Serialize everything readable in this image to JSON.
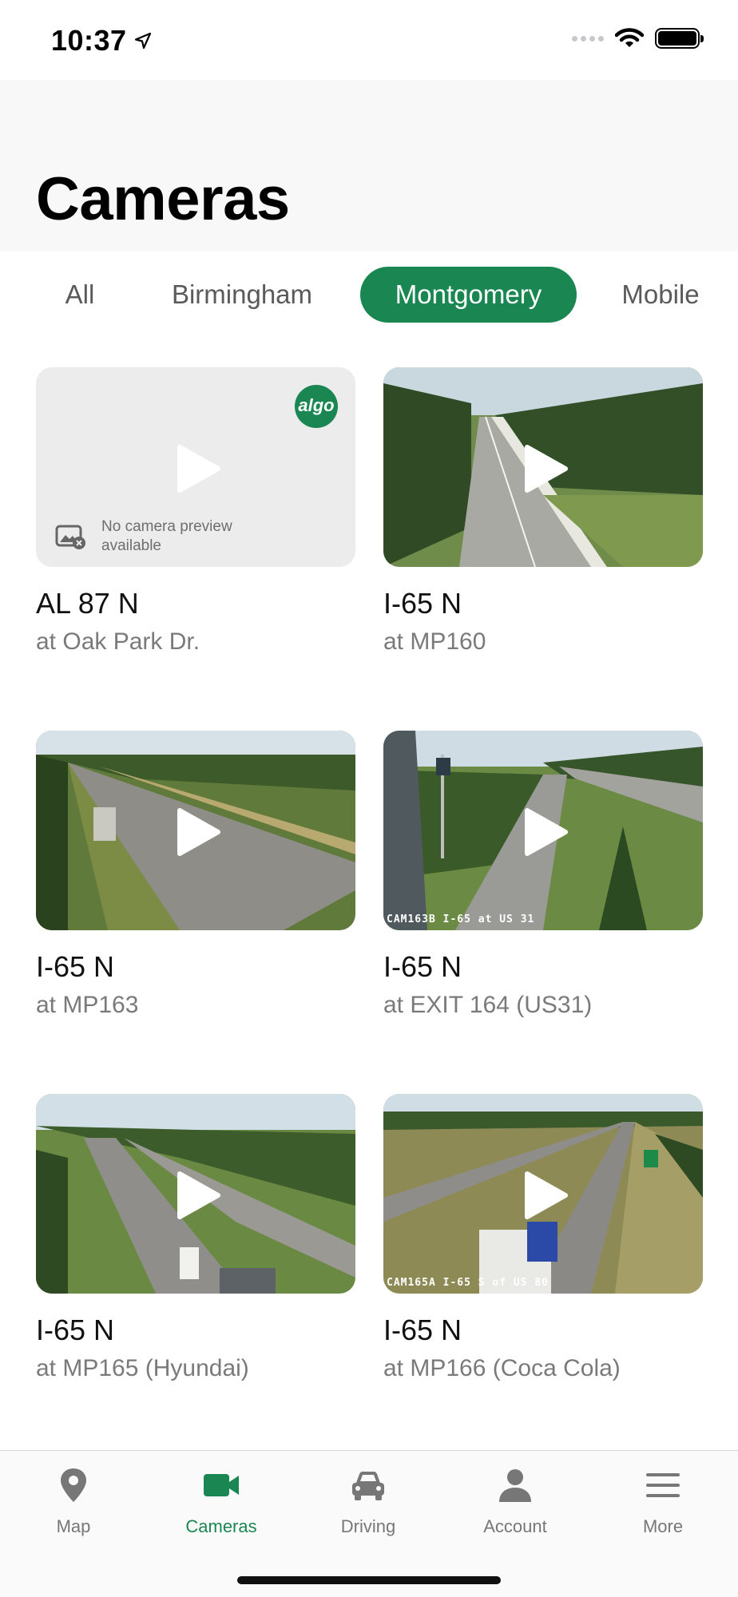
{
  "status_bar": {
    "time": "10:37"
  },
  "header": {
    "title": "Cameras"
  },
  "filters": [
    {
      "label": "All"
    },
    {
      "label": "Birmingham"
    },
    {
      "label": "Montgomery",
      "active": true
    },
    {
      "label": "Mobile"
    }
  ],
  "cameras": [
    {
      "route": "AL 87 N",
      "location": "at Oak Park Dr.",
      "preview": false,
      "no_preview_text": "No camera preview available",
      "badge": "algo"
    },
    {
      "route": "I-65 N",
      "location": "at MP160",
      "preview": true
    },
    {
      "route": "I-65 N",
      "location": "at MP163",
      "preview": true
    },
    {
      "route": "I-65 N",
      "location": "at EXIT 164 (US31)",
      "preview": true,
      "caption": "CAM163B I-65 at US 31"
    },
    {
      "route": "I-65 N",
      "location": "at MP165 (Hyundai)",
      "preview": true
    },
    {
      "route": "I-65 N",
      "location": "at MP166 (Coca Cola)",
      "preview": true,
      "caption": "CAM165A I-65 S of US 80"
    }
  ],
  "tabbar": [
    {
      "label": "Map",
      "icon": "map-pin-icon"
    },
    {
      "label": "Cameras",
      "icon": "video-camera-icon",
      "active": true
    },
    {
      "label": "Driving",
      "icon": "car-icon"
    },
    {
      "label": "Account",
      "icon": "person-icon"
    },
    {
      "label": "More",
      "icon": "menu-icon"
    }
  ],
  "colors": {
    "accent": "#1a8752",
    "inactive_text": "#777777",
    "subtitle": "#7a7a7a"
  }
}
